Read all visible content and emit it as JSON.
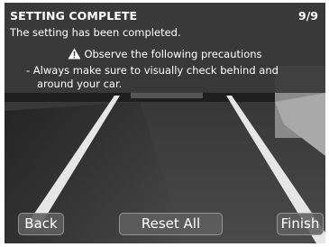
{
  "header": {
    "title": "SETTING COMPLETE",
    "step": "9/9",
    "subtitle": "The setting has been completed."
  },
  "precautions": {
    "icon": "warning-triangle-icon",
    "heading": "Observe the following precautions",
    "text": "- Always make sure to visually check behind and around your car."
  },
  "buttons": {
    "back": "Back",
    "reset_all": "Reset All",
    "finish": "Finish"
  },
  "colors": {
    "header_background": "#3a3a3a",
    "text": "#ffffff",
    "button_background": "#5f5f5f"
  }
}
